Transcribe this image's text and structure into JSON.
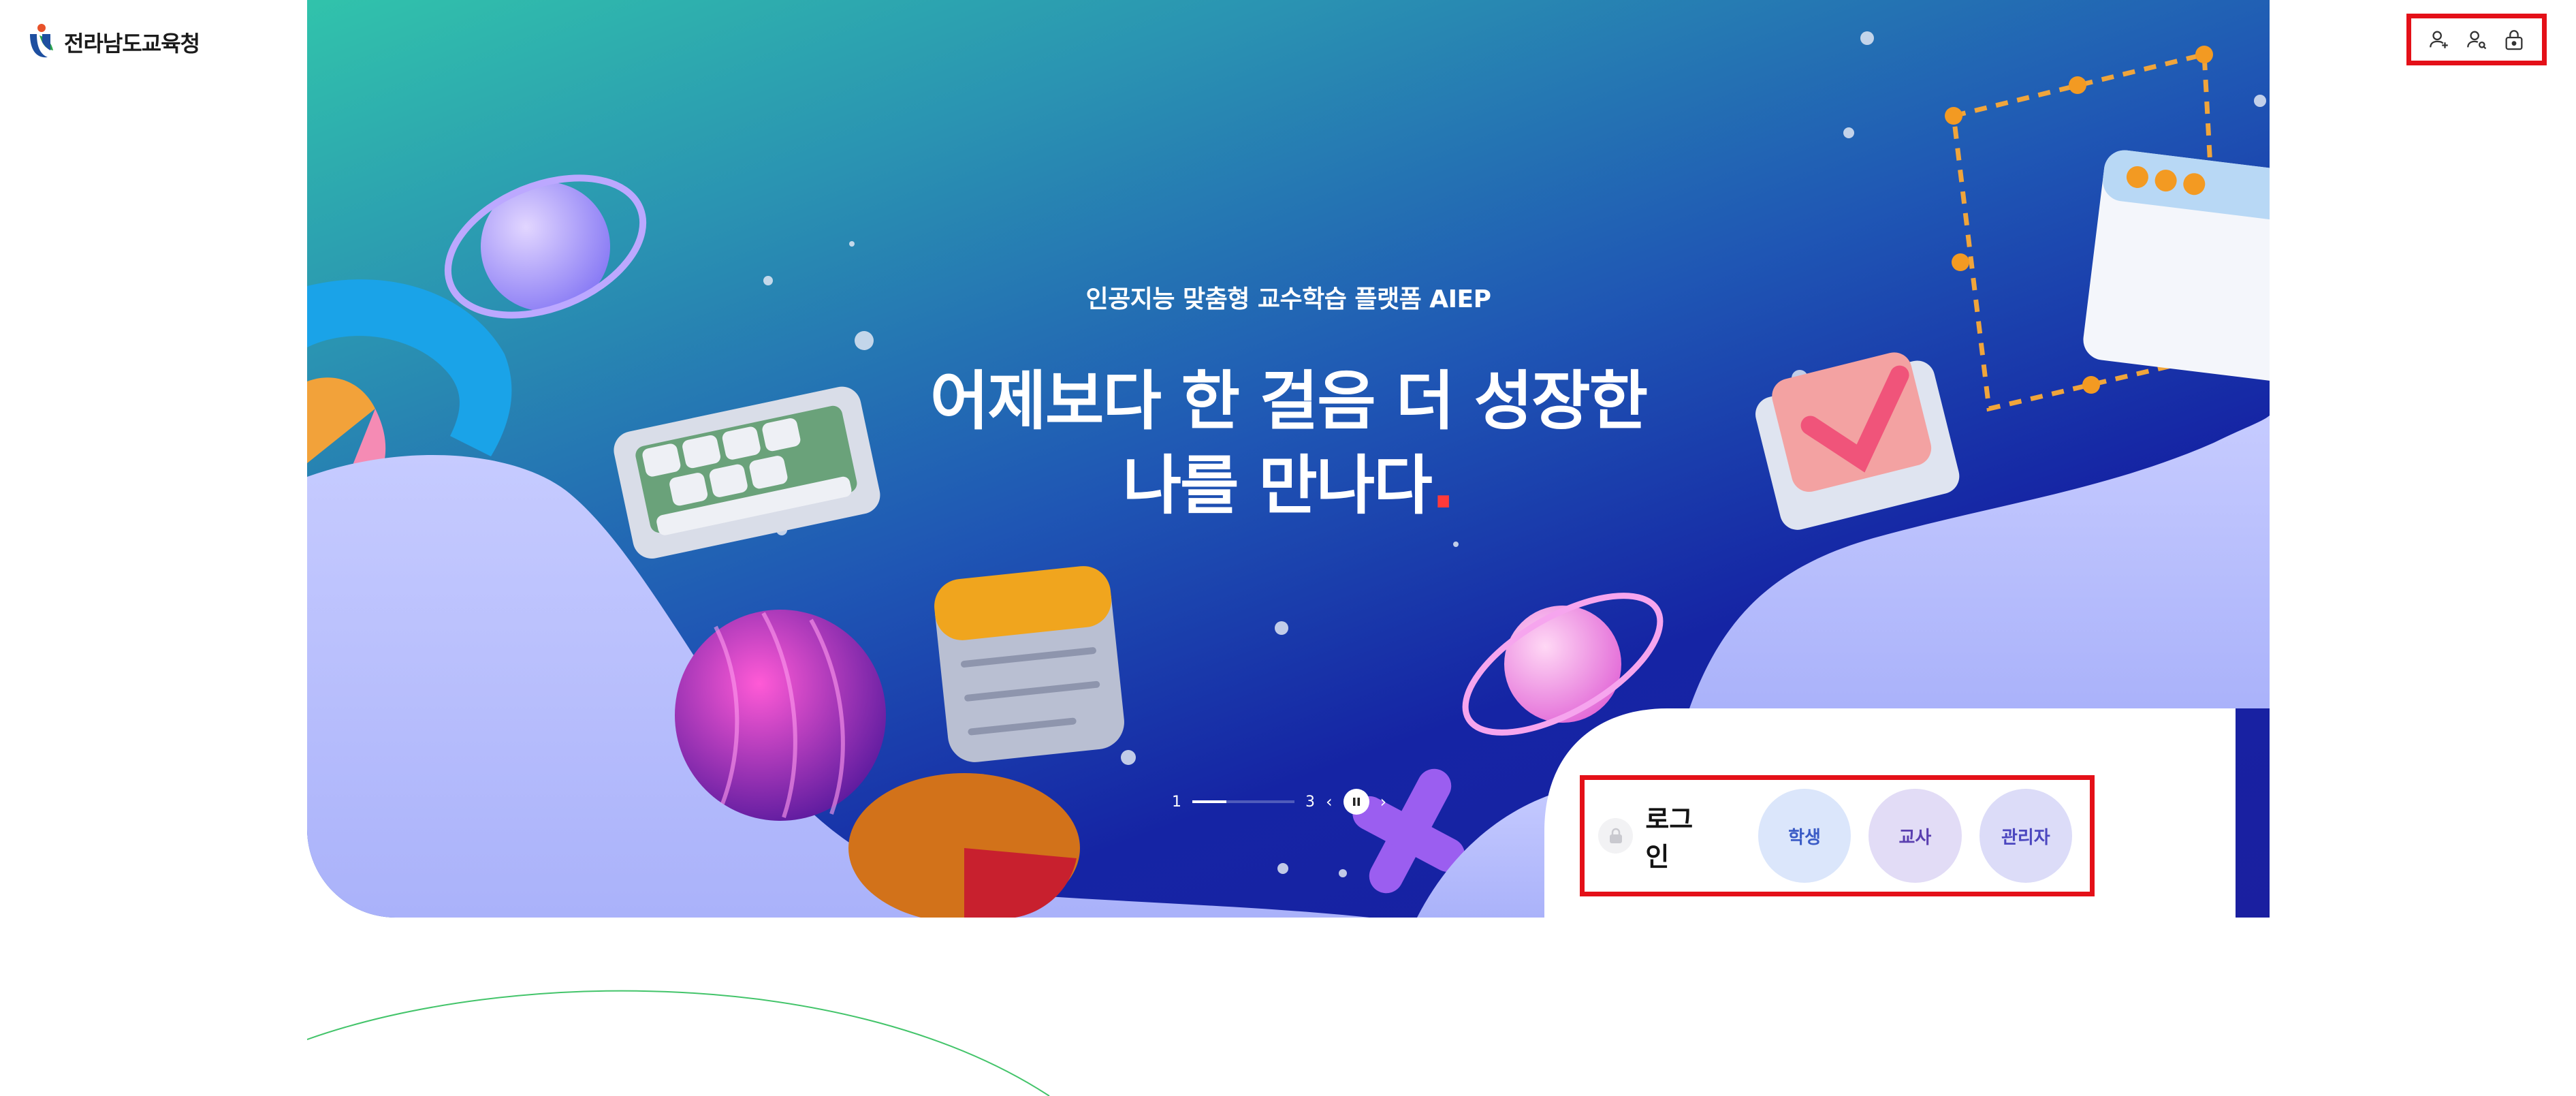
{
  "header": {
    "logo_text": "전라남도교육청",
    "utility_buttons": [
      {
        "name": "signup",
        "icon": "user-add-icon"
      },
      {
        "name": "find-account",
        "icon": "user-search-icon"
      },
      {
        "name": "password",
        "icon": "lock-icon"
      }
    ]
  },
  "hero": {
    "kicker": "인공지능 맞춤형 교수학습 플랫폼 AIEP",
    "title_line1": "어제보다 한 걸음 더 성장한",
    "title_line2": "나를 만나다",
    "title_dot": ".",
    "pager": {
      "current": "1",
      "total": "3",
      "progress": 0.33,
      "prev_icon": "chevron-left-icon",
      "pause_icon": "pause-icon",
      "next_icon": "chevron-right-icon"
    }
  },
  "login": {
    "label": "로그인",
    "icon": "lock-icon",
    "roles": [
      {
        "label": "학생"
      },
      {
        "label": "교사"
      },
      {
        "label": "관리자"
      }
    ]
  },
  "colors": {
    "highlight_border": "#e41018",
    "hero_gradient_start": "#31c3ab",
    "hero_gradient_end": "#1a1fa0",
    "lavender_wave": "#bcc3fb",
    "student_chip": "#dbe6fb",
    "teacher_chip": "#e2dcf6",
    "admin_chip": "#dcdcf8",
    "deco_arc": "#43c46a"
  }
}
